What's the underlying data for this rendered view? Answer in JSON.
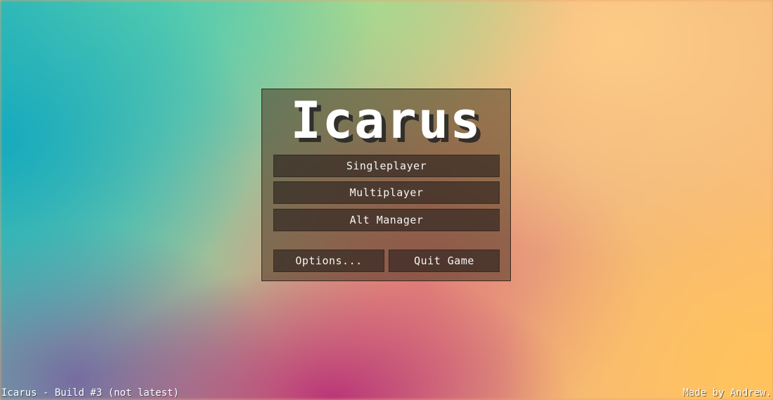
{
  "app": {
    "title": "Icarus"
  },
  "menu": {
    "singleplayer_label": "Singleplayer",
    "multiplayer_label": "Multiplayer",
    "alt_manager_label": "Alt Manager",
    "options_label": "Options...",
    "quit_label": "Quit Game"
  },
  "footer": {
    "build_text": "Icarus - Build #3 (not latest)",
    "credit_text": "Made by Andrew."
  }
}
